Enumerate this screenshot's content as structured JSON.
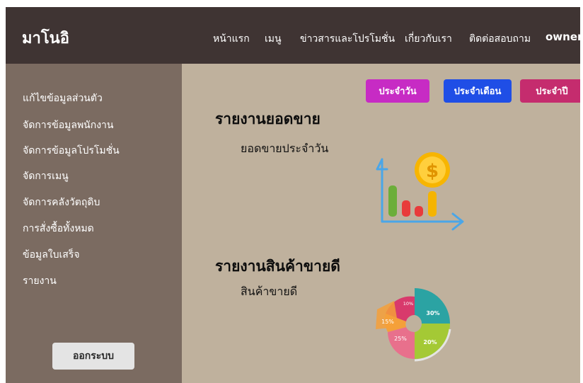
{
  "header": {
    "brand": "มาโนอิ",
    "nav": [
      "หน้าแรก",
      "เมนู",
      "ข่าวสารและโปรโมชั่น",
      "เกี่ยวกับเรา",
      "ติดต่อสอบถาม"
    ],
    "user": "owner"
  },
  "sidebar": {
    "items": [
      "แก้ไขข้อมูลส่วนตัว",
      "จัดการข้อมูลพนักงาน",
      "จัดการข้อมูลโปรโมชั่น",
      "จัดการเมนู",
      "จัดการคลังวัตถุดิบ",
      "การสั่งซื้อทั้งหมด",
      "ข้อมูลใบเสร็จ",
      "รายงาน"
    ],
    "logout": "ออกระบบ"
  },
  "filters": {
    "daily": "ประจำวัน",
    "monthly": "ประจำเดือน",
    "yearly": "ประจำปี"
  },
  "sales_report": {
    "title": "รายงานยอดขาย",
    "subtitle": "ยอดขายประจำวัน"
  },
  "bestseller_report": {
    "title": "รายงานสินค้าขายดี",
    "subtitle": "สินค้าขายดี",
    "slice_labels": [
      "10%",
      "30%",
      "20%",
      "25%",
      "15%"
    ]
  },
  "colors": {
    "topbar": "#3f3433",
    "sidebar": "#7b6b61",
    "main": "#bfb19d",
    "daily": "#c72bc4",
    "monthly": "#1f4ee6",
    "yearly": "#c52c6e"
  },
  "icons": {
    "sales": "bar-chart-coin-icon",
    "bestseller": "pie-donut-chart-icon"
  }
}
